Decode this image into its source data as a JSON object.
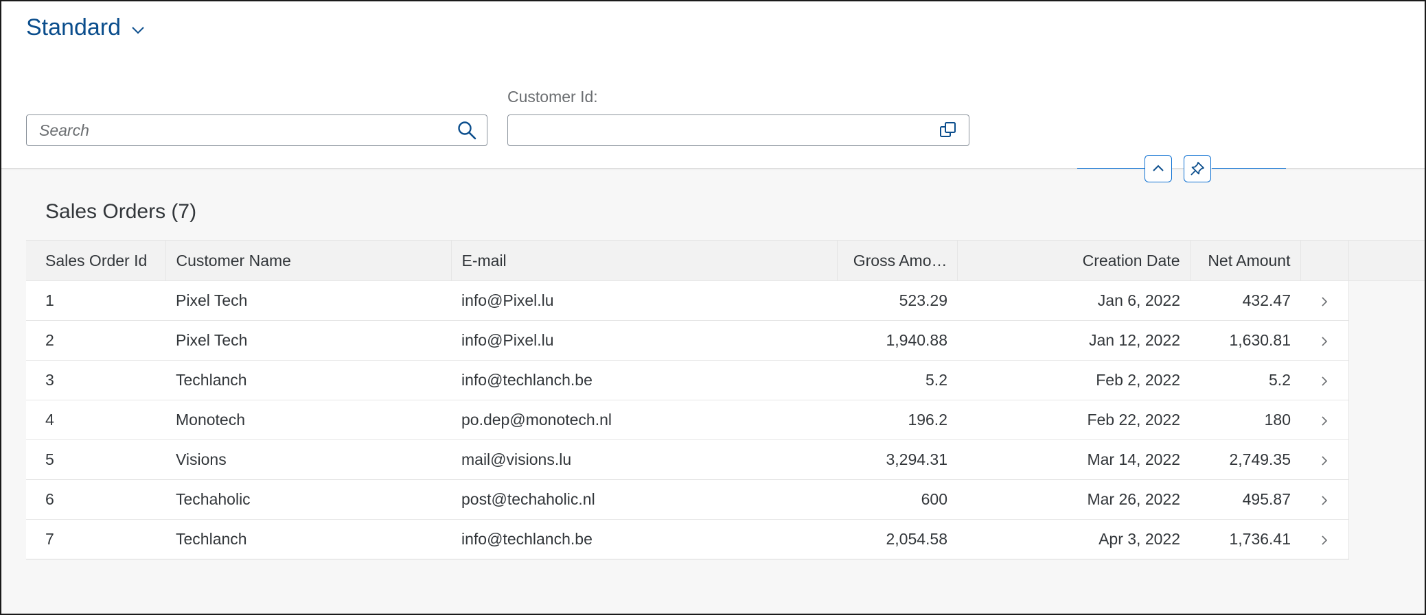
{
  "header": {
    "variant_title": "Standard",
    "search": {
      "placeholder": "Search",
      "value": ""
    },
    "filters": [
      {
        "label": "Customer Id:",
        "value": ""
      }
    ]
  },
  "table": {
    "title": "Sales Orders (7)",
    "columns": [
      "Sales Order Id",
      "Customer Name",
      "E-mail",
      "Gross Amo…",
      "Creation Date",
      "Net Amount"
    ],
    "rows": [
      [
        "1",
        "Pixel Tech",
        "info@Pixel.lu",
        "523.29",
        "Jan 6, 2022",
        "432.47"
      ],
      [
        "2",
        "Pixel Tech",
        "info@Pixel.lu",
        "1,940.88",
        "Jan 12, 2022",
        "1,630.81"
      ],
      [
        "3",
        "Techlanch",
        "info@techlanch.be",
        "5.2",
        "Feb 2, 2022",
        "5.2"
      ],
      [
        "4",
        "Monotech",
        "po.dep@monotech.nl",
        "196.2",
        "Feb 22, 2022",
        "180"
      ],
      [
        "5",
        "Visions",
        "mail@visions.lu",
        "3,294.31",
        "Mar 14, 2022",
        "2,749.35"
      ],
      [
        "6",
        "Techaholic",
        "post@techaholic.nl",
        "600",
        "Mar 26, 2022",
        "495.87"
      ],
      [
        "7",
        "Techlanch",
        "info@techlanch.be",
        "2,054.58",
        "Apr 3, 2022",
        "1,736.41"
      ]
    ]
  },
  "colors": {
    "brand_blue": "#0a4d8c",
    "accent_blue": "#0a6ed1",
    "text": "#32363a",
    "background": "#f7f7f7"
  },
  "icons": {
    "variant": "chevron-down-icon",
    "search": "search-icon",
    "value_help": "value-help-icon",
    "collapse": "chevron-up-icon",
    "pin": "pin-icon",
    "row_nav": "chevron-right-icon"
  }
}
